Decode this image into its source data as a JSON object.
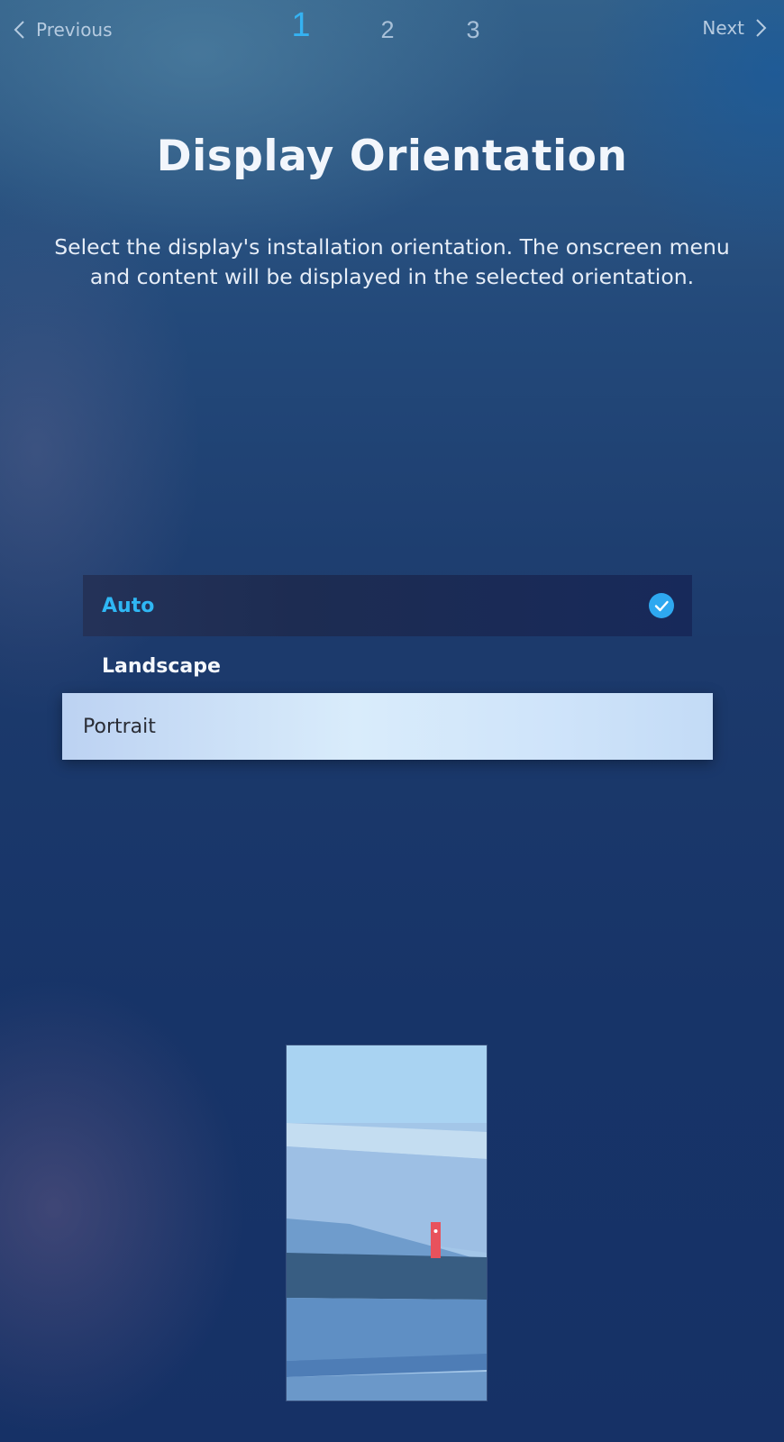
{
  "nav": {
    "previous_label": "Previous",
    "next_label": "Next",
    "steps": [
      "1",
      "2",
      "3"
    ],
    "active_step": 1
  },
  "page": {
    "title": "Display Orientation",
    "description": "Select the display's installation orientation. The onscreen menu and content will be displayed in the selected orientation."
  },
  "options": {
    "items": [
      {
        "label": "Auto",
        "selected": true
      },
      {
        "label": "Landscape",
        "selected": false
      },
      {
        "label": "Portrait",
        "selected": false,
        "focused": true
      }
    ]
  },
  "icons": {
    "previous": "chevron-left-icon",
    "next": "chevron-right-icon",
    "selected": "checkmark-circle-icon"
  },
  "colors": {
    "accent": "#2fb7f4",
    "selected_row": "#1d2c52",
    "focus_row": "#d9ecfb",
    "preview_marker": "#e8525c"
  }
}
